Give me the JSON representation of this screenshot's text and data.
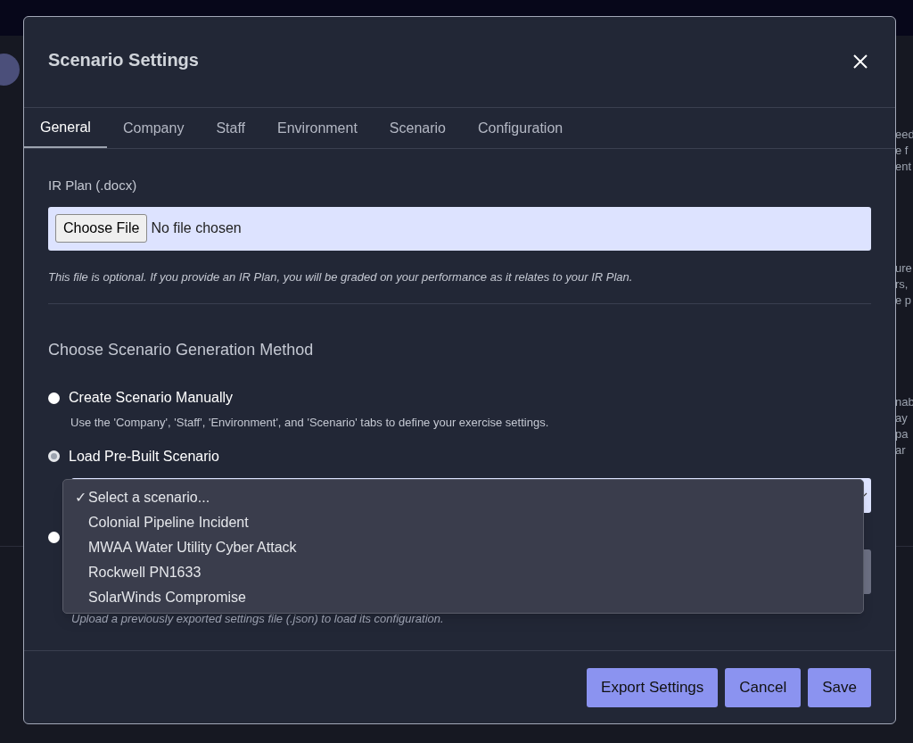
{
  "background_page": {
    "text_fragments": [
      "eed",
      "e f",
      "ent",
      "ure",
      "rs,",
      "e p",
      "nab",
      "ay",
      "pa",
      "ar"
    ]
  },
  "dialog": {
    "title": "Scenario Settings"
  },
  "tabs": [
    {
      "label": "General",
      "selected": true
    },
    {
      "label": "Company",
      "selected": false
    },
    {
      "label": "Staff",
      "selected": false
    },
    {
      "label": "Environment",
      "selected": false
    },
    {
      "label": "Scenario",
      "selected": false
    },
    {
      "label": "Configuration",
      "selected": false
    }
  ],
  "ir_plan": {
    "label": "IR Plan (.docx)",
    "button": "Choose File",
    "status": "No file chosen",
    "help": "This file is optional. If you provide an IR Plan, you will be graded on your performance as it relates to your IR Plan."
  },
  "method": {
    "heading": "Choose Scenario Generation Method",
    "options": [
      {
        "label": "Create Scenario Manually",
        "description": "Use the 'Company', 'Staff', 'Environment', and 'Scenario' tabs to define your exercise settings.",
        "selected": false
      },
      {
        "label": "Load Pre-Built Scenario",
        "selected": true
      },
      {
        "selected": false
      }
    ]
  },
  "scenario_dropdown": {
    "check_mark": "✓",
    "options": [
      {
        "label": "Select a scenario...",
        "selected": true
      },
      {
        "label": "Colonial Pipeline Incident",
        "selected": false
      },
      {
        "label": "MWAA Water Utility Cyber Attack",
        "selected": false
      },
      {
        "label": "Rockwell PN1633",
        "selected": false
      },
      {
        "label": "SolarWinds Compromise",
        "selected": false
      }
    ]
  },
  "upload_help": "Upload a previously exported settings file (.json) to load its configuration.",
  "buttons": [
    "Export Settings",
    "Cancel",
    "Save"
  ]
}
